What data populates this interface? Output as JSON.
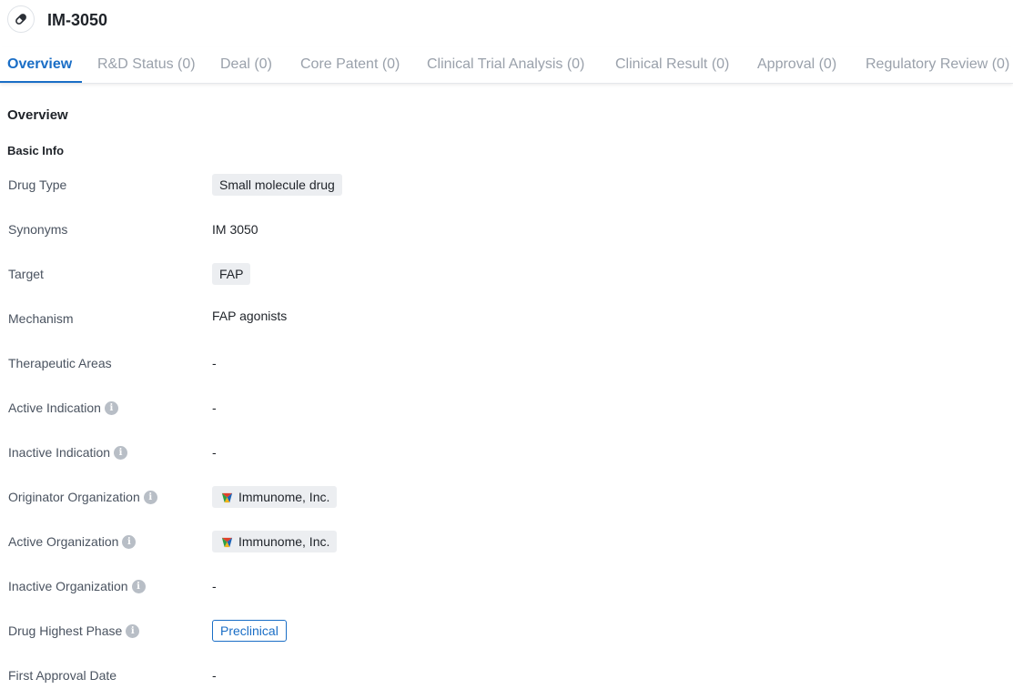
{
  "header": {
    "title": "IM-3050",
    "icon": "pill-icon"
  },
  "tabs": [
    {
      "label": "Overview",
      "active": true
    },
    {
      "label": "R&D Status (0)"
    },
    {
      "label": "Deal (0)"
    },
    {
      "label": "Core Patent (0)"
    },
    {
      "label": "Clinical Trial Analysis (0)"
    },
    {
      "label": "Clinical Result (0)"
    },
    {
      "label": "Approval (0)"
    },
    {
      "label": "Regulatory Review (0)"
    }
  ],
  "overview": {
    "title": "Overview",
    "basic_info_title": "Basic Info",
    "fields": {
      "drug_type": {
        "label": "Drug Type",
        "value": "Small molecule drug"
      },
      "synonyms": {
        "label": "Synonyms",
        "value": "IM 3050"
      },
      "target": {
        "label": "Target",
        "value": "FAP"
      },
      "mechanism": {
        "label": "Mechanism",
        "value": "FAP agonists"
      },
      "therapeutic_areas": {
        "label": "Therapeutic Areas",
        "value": "-"
      },
      "active_indication": {
        "label": "Active Indication",
        "value": "-"
      },
      "inactive_indication": {
        "label": "Inactive Indication",
        "value": "-"
      },
      "originator_organization": {
        "label": "Originator Organization",
        "value": "Immunome, Inc."
      },
      "active_organization": {
        "label": "Active Organization",
        "value": "Immunome, Inc."
      },
      "inactive_organization": {
        "label": "Inactive Organization",
        "value": "-"
      },
      "drug_highest_phase": {
        "label": "Drug Highest Phase",
        "value": "Preclinical"
      },
      "first_approval_date": {
        "label": "First Approval Date",
        "value": "-"
      }
    }
  },
  "info_icon_glyph": "i",
  "colors": {
    "accent": "#1a6ec6",
    "tab_inactive": "#9aa1ab",
    "tag_bg": "#eceef1"
  }
}
